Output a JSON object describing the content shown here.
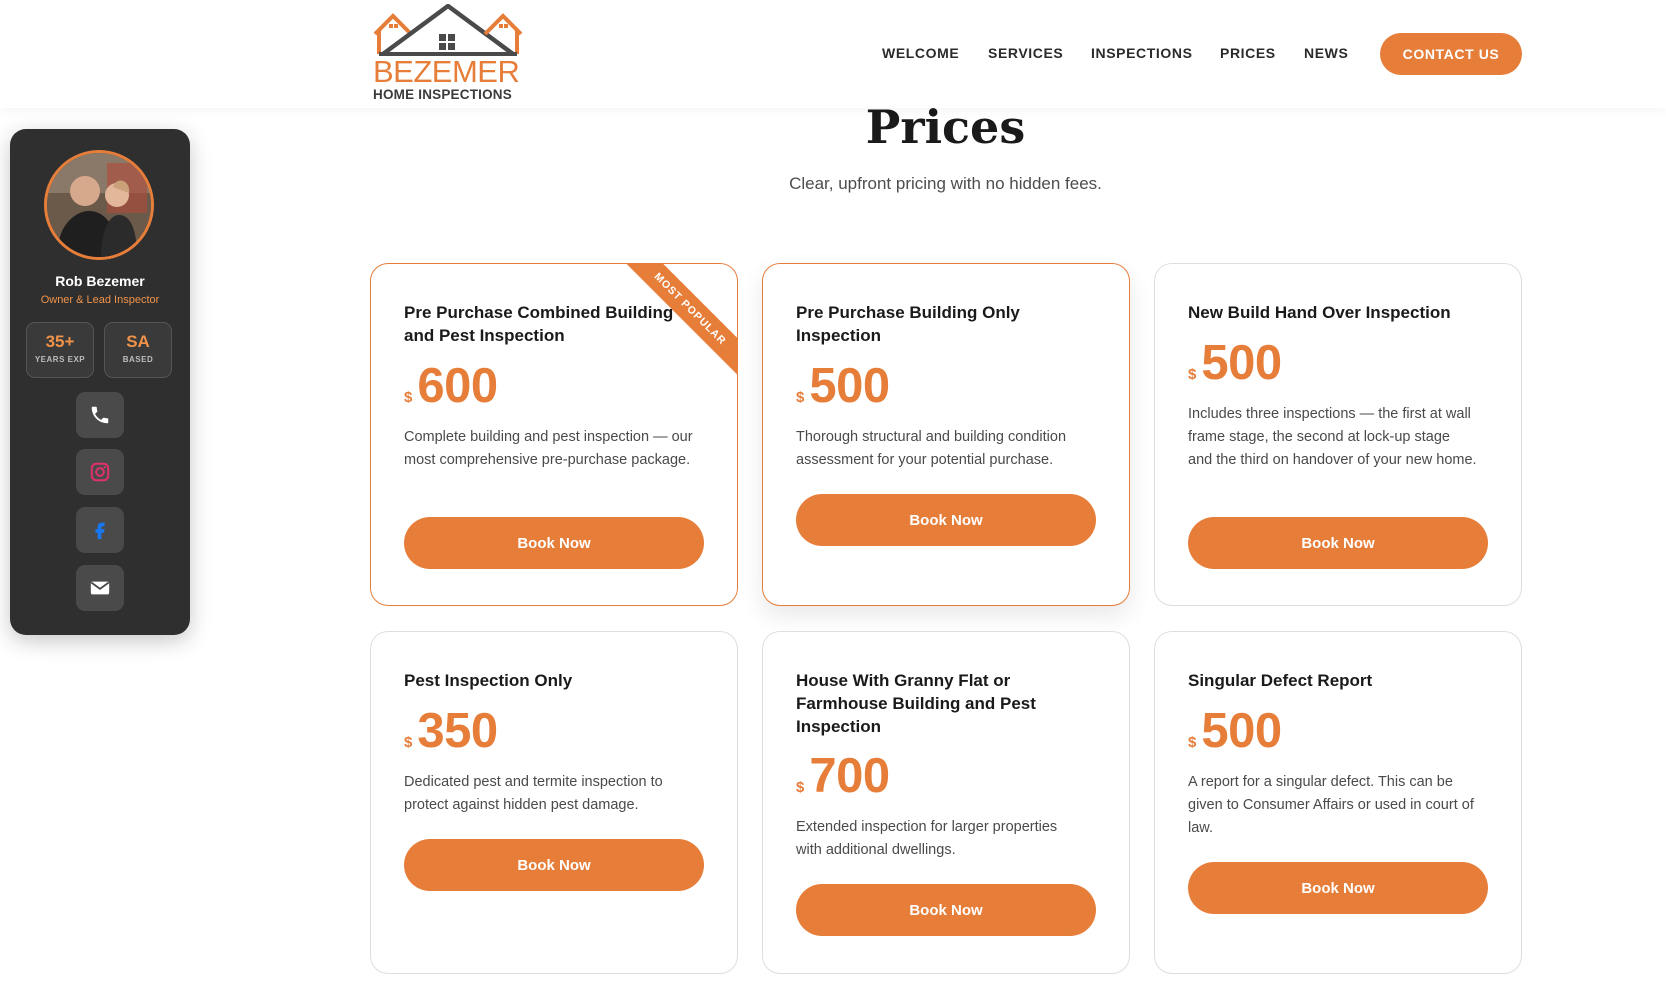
{
  "brand": {
    "name": "BEZEMER",
    "tagline": "HOME INSPECTIONS",
    "accent_color": "#e67e3a",
    "dark_color": "#3b3b3b"
  },
  "nav": {
    "items": [
      "WELCOME",
      "SERVICES",
      "INSPECTIONS",
      "PRICES",
      "NEWS"
    ],
    "contact_label": "CONTACT US"
  },
  "page": {
    "title": "Prices",
    "subtitle": "Clear, upfront pricing with no hidden fees."
  },
  "profile": {
    "name": "Rob Bezemer",
    "role": "Owner & Lead Inspector",
    "stats": [
      {
        "value": "35+",
        "label": "YEARS EXP"
      },
      {
        "value": "SA",
        "label": "BASED"
      }
    ],
    "socials": [
      "phone-icon",
      "instagram-icon",
      "facebook-icon",
      "email-icon"
    ]
  },
  "cards": [
    {
      "title": "Pre Purchase Combined Building and Pest Inspection",
      "currency": "$",
      "price": "600",
      "description": "Complete building and pest inspection — our most comprehensive pre-purchase package.",
      "button": "Book Now",
      "ribbon": "MOST POPULAR"
    },
    {
      "title": "Pre Purchase Building Only Inspection",
      "currency": "$",
      "price": "500",
      "description": "Thorough structural and building condition assessment for your potential purchase.",
      "button": "Book Now"
    },
    {
      "title": "New Build Hand Over Inspection",
      "currency": "$",
      "price": "500",
      "description": "Includes three inspections — the first at wall frame stage, the second at lock-up stage and the third on handover of your new home.",
      "button": "Book Now"
    },
    {
      "title": "Pest Inspection Only",
      "currency": "$",
      "price": "350",
      "description": "Dedicated pest and termite inspection to protect against hidden pest damage.",
      "button": "Book Now"
    },
    {
      "title": "House With Granny Flat or Farmhouse Building and Pest Inspection",
      "currency": "$",
      "price": "700",
      "description": "Extended inspection for larger properties with additional dwellings.",
      "button": "Book Now"
    },
    {
      "title": "Singular Defect Report",
      "currency": "$",
      "price": "500",
      "description": "A report for a singular defect. This can be given to Consumer Affairs or used in court of law.",
      "button": "Book Now"
    }
  ]
}
